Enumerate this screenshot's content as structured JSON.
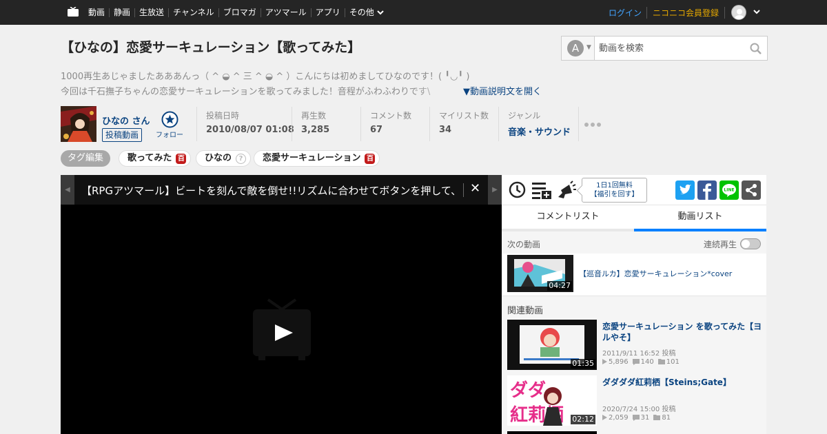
{
  "nav": {
    "items": [
      "動画",
      "静画",
      "生放送",
      "チャンネル",
      "ブロマガ",
      "アツマール",
      "アプリ"
    ],
    "more": "その他",
    "login": "ログイン",
    "register": "ニコニコ会員登録"
  },
  "video": {
    "title": "【ひなの】恋愛サーキュレーション【歌ってみた】",
    "description_line1": "1000再生あじゃましたあああんっ（ ^ ◒ ^ 三 ^ ◒ ^ ）こんにちは初めましてひなのです！( ╹◡╹ )",
    "description_line2": "今回は千石撫子ちゃんの恋愛サーキュレーションを歌ってみました！音程がふわふわりです\\",
    "open_description": "▼動画説明文を開く"
  },
  "search": {
    "mode_letter": "A",
    "placeholder": "動画を検索"
  },
  "owner": {
    "name": "ひなの さん",
    "videos_button": "投稿動画",
    "follow_label": "フォロー"
  },
  "stats": [
    {
      "label": "投稿日時",
      "value": "2010/08/07 01:08"
    },
    {
      "label": "再生数",
      "value": "3,285"
    },
    {
      "label": "コメント数",
      "value": "67"
    },
    {
      "label": "マイリスト数",
      "value": "34"
    },
    {
      "label": "ジャンル",
      "value": "音楽・サウンド"
    }
  ],
  "tags": {
    "edit_label": "タグ編集",
    "items": [
      {
        "name": "歌ってみた",
        "badge": "百"
      },
      {
        "name": "ひなの",
        "badge": "?"
      },
      {
        "name": "恋愛サーキュレーション",
        "badge": "百"
      }
    ]
  },
  "player": {
    "ad_text": "【RPGアツマール】ビートを刻んで敵を倒せ!!リズムに合わせてボタンを押して、ステージ",
    "close": "✕"
  },
  "panel": {
    "bubble_line1": "1日1回無料",
    "bubble_line2": "【福引を回す】",
    "tabs": [
      "コメントリスト",
      "動画リスト"
    ],
    "next_label": "次の動画",
    "autoplay_label": "連続再生",
    "next_video": {
      "title": "【巡音ルカ】恋愛サーキュレーション*cover",
      "duration": "04:27"
    },
    "related_label": "関連動画",
    "related": [
      {
        "title": "恋愛サーキュレーション を歌ってみた【ヨルやそ】",
        "date": "2011/9/11 16:52 投稿",
        "views": "5,896",
        "comments": "140",
        "mylists": "101",
        "duration": "01:35"
      },
      {
        "title": "ダダダダ紅莉栖【Steins;Gate】",
        "date": "2020/7/24 15:00 投稿",
        "views": "2,059",
        "comments": "31",
        "mylists": "81",
        "duration": "02:12"
      }
    ]
  },
  "colors": {
    "topbar": "#252525",
    "link": "#0a4380",
    "login": "#42a4ff",
    "register": "#e5a800",
    "tab_active": "#0080ff",
    "twitter": "#1da1f2",
    "facebook": "#3b5998",
    "line": "#00c300",
    "share": "#555555"
  }
}
